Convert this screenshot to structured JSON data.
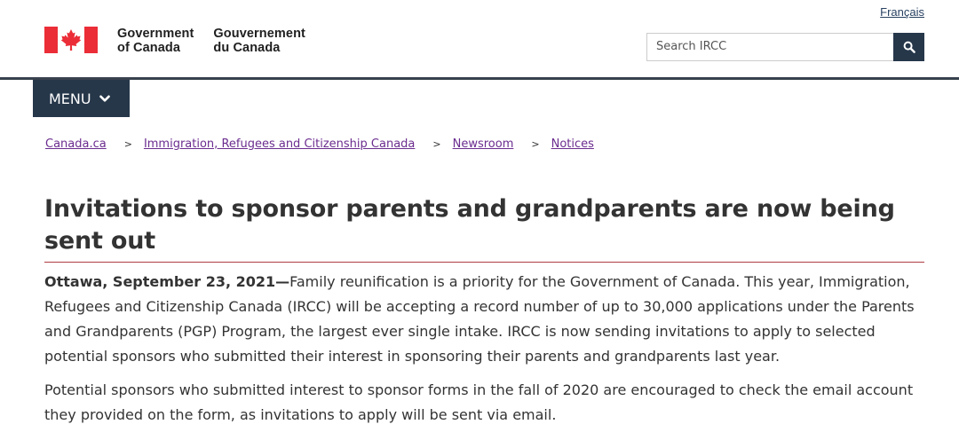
{
  "header": {
    "language_link": "Français",
    "signature": {
      "en_line1": "Government",
      "en_line2": "of Canada",
      "fr_line1": "Gouvernement",
      "fr_line2": "du Canada"
    },
    "search": {
      "placeholder": "Search IRCC",
      "button_icon": "search-icon"
    }
  },
  "menu": {
    "label": "MENU",
    "icon": "chevron-down-icon"
  },
  "breadcrumb": [
    {
      "label": "Canada.ca"
    },
    {
      "label": "Immigration, Refugees and Citizenship Canada"
    },
    {
      "label": "Newsroom"
    },
    {
      "label": "Notices"
    }
  ],
  "breadcrumb_separator": ">",
  "article": {
    "title": "Invitations to sponsor parents and grandparents are now being sent out",
    "dateline": "Ottawa, September 23, 2021—",
    "paragraph1": "Family reunification is a priority for the Government of Canada. This year, Immigration, Refugees and Citizenship Canada (IRCC) will be accepting a record number of up to 30,000 applications under the Parents and Grandparents (PGP) Program, the largest ever single intake. IRCC is now sending invitations to apply to selected potential sponsors who submitted their interest in sponsoring their parents and grandparents last year.",
    "paragraph2": "Potential sponsors who submitted interest to sponsor forms in the fall of 2020 are encouraged to check the email account they provided on the form, as invitations to apply will be sent via email."
  },
  "colors": {
    "flag_red": "#eb2d37",
    "nav_dark": "#26374a",
    "link_visited": "#6b2d8f",
    "title_rule": "#af3c43"
  }
}
